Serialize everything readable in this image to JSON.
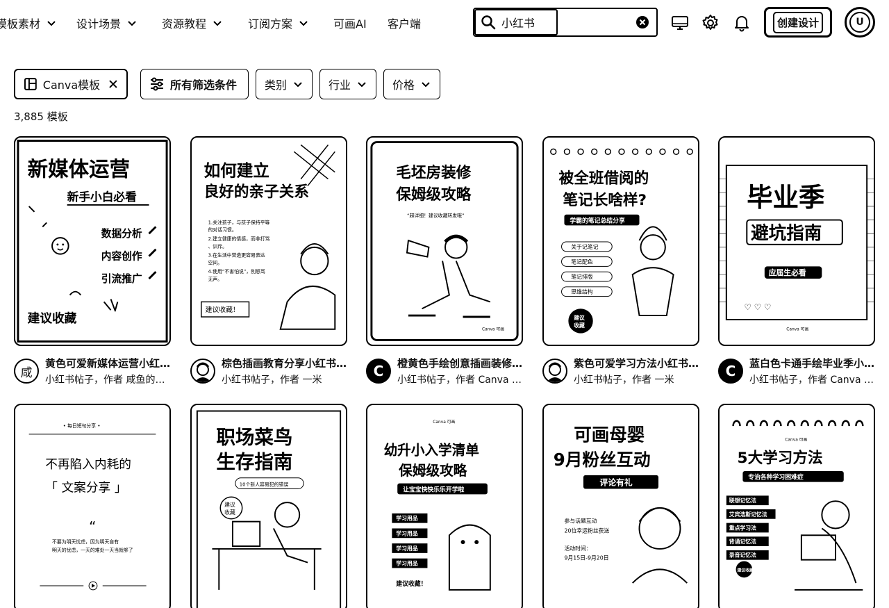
{
  "nav": {
    "items": [
      {
        "label": "模板素材"
      },
      {
        "label": "设计场景"
      },
      {
        "label": "资源教程"
      },
      {
        "label": "订阅方案"
      },
      {
        "label": "可画AI"
      },
      {
        "label": "客户端"
      }
    ],
    "search": {
      "value": "小红书"
    },
    "icons": [
      "desktop-icon",
      "settings-icon",
      "bell-icon"
    ],
    "create_label": "创建设计",
    "avatar_letter": "U"
  },
  "filters": {
    "active_chip": "Canva模板",
    "all_filters": "所有筛选条件",
    "category": "类别",
    "industry": "行业",
    "price": "价格"
  },
  "result_count": "3,885 模板",
  "cards": [
    {
      "title": "黄色可爱新媒体运营小红书帖子",
      "subtitle": "小红书帖子，作者 咸鱼的团队",
      "avatar": "咸",
      "thumb": {
        "headline": "新媒体运营",
        "sub": "新手小白必看",
        "points": [
          "数据分析",
          "内容创作",
          "引流推广"
        ],
        "footer": "建议收藏"
      }
    },
    {
      "title": "棕色插画教育分享小红书帖子",
      "subtitle": "小红书帖子，作者 一米",
      "avatar": "",
      "thumb": {
        "headline": [
          "如何建立",
          "良好的亲子关系"
        ],
        "lines": [
          "1.关注孩子，与孩子保持平等",
          "的对话习惯。",
          "2.建立健康的情感，而非打骂",
          "、训斥。",
          "3.在生活中营造更容易表达",
          "空间。",
          "4.使用“不害怕说”，别怒骂",
          "无声。"
        ],
        "footer": "建议收藏！"
      }
    },
    {
      "title": "橙黄色手绘创意插画装修小红书帖子",
      "subtitle": "小红书帖子，作者 Canva Creative Studio",
      "avatar": "C",
      "thumb": {
        "headline": [
          "毛坯房装修",
          "保姆级攻略"
        ],
        "sub": "“超详细！建议收藏转发哦”",
        "footer": "Canva 可画"
      }
    },
    {
      "title": "紫色可爱学习方法小红书帖子",
      "subtitle": "小红书帖子，作者 一米",
      "avatar": "",
      "thumb": {
        "headline": [
          "被全班借阅的",
          "笔记长啥样?"
        ],
        "sub": "学霸的笔记总结分享",
        "checks": [
          "关于记笔记",
          "笔记配色",
          "笔记排版",
          "思维结构"
        ],
        "badge": [
          "建议",
          "收藏"
        ]
      }
    },
    {
      "title": "蓝白色卡通手绘毕业季小红书帖子",
      "subtitle": "小红书帖子，作者 Canva Creative Studio",
      "avatar": "C",
      "thumb": {
        "headline": "毕业季",
        "sub": "避坑指南",
        "tag": "应届生必看",
        "footer": "Canva 可画"
      }
    },
    {
      "thumb": {
        "top": "• 每日短句分享 •",
        "headline": "不再陷入内耗的",
        "bracket": "「 文案分享 」",
        "quote": "“",
        "lines": [
          "不要为明天忧虑，因为明天自有",
          "明天的忧虑，一天的难处一天当就够了"
        ]
      }
    },
    {
      "thumb": {
        "headline": [
          "职场菜鸟",
          "生存指南"
        ],
        "sub": "10个新人容易犯的错误",
        "stamp": [
          "建议",
          "收藏"
        ]
      }
    },
    {
      "thumb": {
        "logo": "Canva 可画",
        "headline": [
          "幼升小入学清单",
          "保姆级攻略"
        ],
        "sub": "让宝宝快快乐乐开学啦",
        "items": [
          "学习用品",
          "学习用品",
          "学习用品",
          "学习用品"
        ],
        "footer": "建议收藏！"
      }
    },
    {
      "thumb": {
        "headline": [
          "可画母婴",
          "9月粉丝互动"
        ],
        "tag": "评论有礼",
        "lines": [
          "参与话题互动",
          "20位幸运粉丝获送",
          "活动时间：",
          "9月15日-9月20日"
        ]
      }
    },
    {
      "thumb": {
        "logo": "Canva 可画",
        "headline": "5大学习方法",
        "sub": "专治各种学习困难症",
        "items": [
          "联想记忆法",
          "艾宾浩斯记忆法",
          "重点学习法",
          "背诵记忆法",
          "录音记忆法"
        ],
        "footer": "建议收藏"
      }
    }
  ]
}
